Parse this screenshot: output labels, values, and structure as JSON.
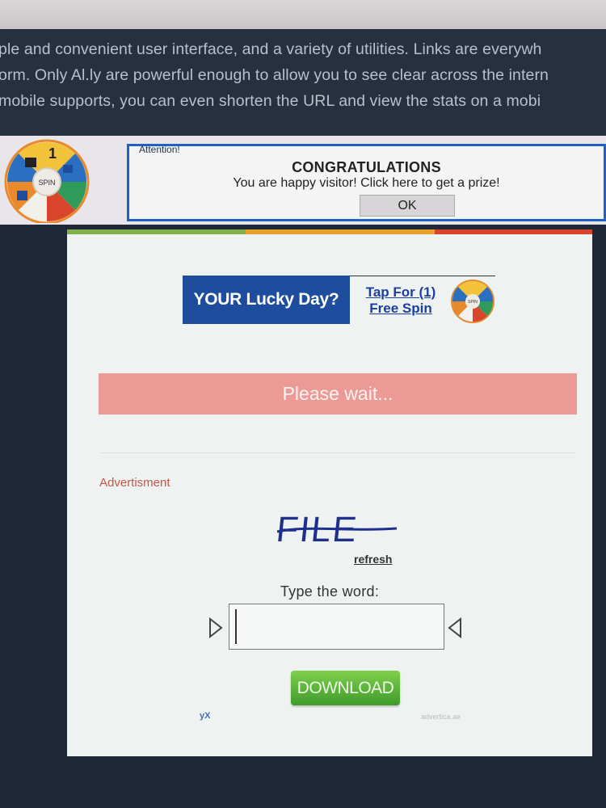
{
  "intro": {
    "lines": [
      "ple and convenient user interface, and a variety of utilities. Links are everywh",
      "orm. Only Al.ly are powerful enough to allow you to see clear across the intern",
      "mobile supports, you can even shorten the URL and view the stats on a mobi"
    ]
  },
  "banner": {
    "wheel": {
      "center_label": "SPIN",
      "top_number": "1"
    },
    "popup": {
      "attention": "Attention!",
      "title": "CONGRATULATIONS",
      "message": "You are happy visitor! Click here to get a prize!",
      "ok_label": "OK",
      "border_color": "#1d62c4"
    }
  },
  "card": {
    "lucky": {
      "headline": "YOUR Lucky Day?",
      "tap_line1": "Tap For (1)",
      "tap_line2": "Free Spin",
      "wheel_label": "SPIN"
    },
    "wait_label": "Please wait...",
    "advertisment": "Advertisment",
    "captcha": {
      "word": "FILE",
      "refresh_label": "refresh",
      "prompt": "Type the word:",
      "input_value": ""
    },
    "download_label": "DOWNLOAD",
    "footer_left": "yX",
    "footer_right": "advertica.ae"
  },
  "colors": {
    "page_bg": "#1e2837",
    "lucky_blue": "#1d4d9c",
    "wait_bg": "#ec9a96",
    "download_green": "#4fae33",
    "advert_red": "#c0574f"
  }
}
